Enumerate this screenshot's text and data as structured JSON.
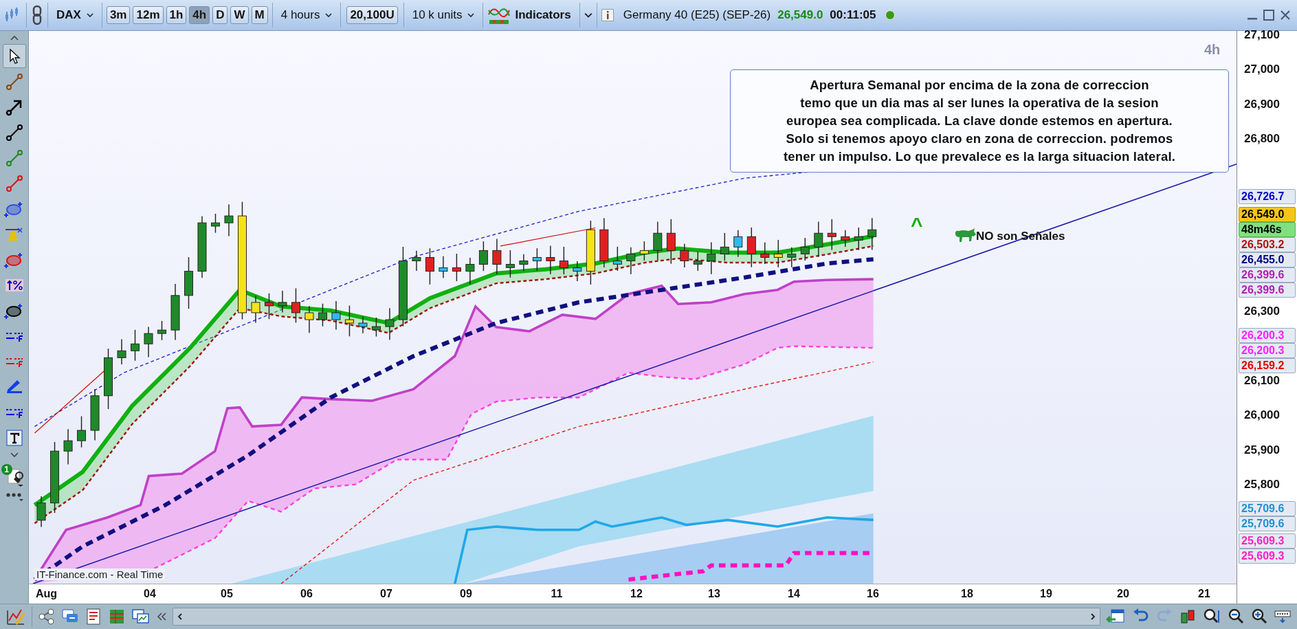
{
  "toolbar": {
    "symbol": "DAX",
    "timeframes": [
      {
        "label": "3m",
        "selected": false
      },
      {
        "label": "12m",
        "selected": false
      },
      {
        "label": "1h",
        "selected": false
      },
      {
        "label": "4h",
        "selected": true
      },
      {
        "label": "D",
        "selected": false
      },
      {
        "label": "W",
        "selected": false
      },
      {
        "label": "M",
        "selected": false
      }
    ],
    "period": "4 hours",
    "quantity_button": "20,100U",
    "units": "10 k units",
    "indicators": "Indicators",
    "instrument": "Germany 40 (E25) (SEP-26)",
    "price": "26,549.0",
    "countdown": "00:11:05",
    "connected": true
  },
  "drawing_tools": [
    {
      "kind": "pointer",
      "selected": true
    },
    {
      "kind": "segment",
      "selected": false
    },
    {
      "kind": "arrow",
      "selected": false
    },
    {
      "kind": "segment",
      "selected": false
    },
    {
      "kind": "segment",
      "selected": false
    },
    {
      "kind": "segment",
      "selected": false
    },
    {
      "kind": "ellipse",
      "selected": false
    },
    {
      "kind": "alert",
      "selected": false
    },
    {
      "kind": "ellipse",
      "selected": false
    },
    {
      "kind": "percent",
      "selected": false
    },
    {
      "kind": "ellipse",
      "selected": false
    },
    {
      "kind": "levels",
      "selected": false
    },
    {
      "kind": "levels",
      "selected": false
    },
    {
      "kind": "pencil",
      "selected": false
    },
    {
      "kind": "levels",
      "selected": false
    },
    {
      "kind": "text",
      "selected": false
    }
  ],
  "tools_badge": "1",
  "chart": {
    "timeframe_label": "4h",
    "note": [
      "Apertura Semanal por encima de la zona de correccion",
      "temo que un dia mas al ser lunes la operativa de la sesion",
      "europea sea complicada. La clave donde estemos en apertura.",
      "Solo si tenemos apoyo claro en zona de correccion. podremos",
      "tener un impulso. Lo que prevalece es la larga situacion lateral."
    ],
    "marker": "^",
    "signal_label": "NO son Señales",
    "source": "IT-Finance.com - Real Time",
    "price_ticks": [
      "27,100",
      "27,000",
      "26,900",
      "26,800",
      "26,300",
      "26,100",
      "26,000",
      "25,900",
      "25,800"
    ],
    "price_tags": [
      {
        "text": "26,726.7",
        "kind": "line",
        "color": "#0000c8"
      },
      {
        "text": "26,549.0",
        "kind": "last"
      },
      {
        "text": "48m46s",
        "kind": "timer"
      },
      {
        "text": "26,503.2",
        "kind": "line",
        "color": "#b01010"
      },
      {
        "text": "26,455.0",
        "kind": "line",
        "color": "#000080"
      },
      {
        "text": "26,399.6",
        "kind": "line",
        "color": "#b020b0"
      },
      {
        "text": "26,399.6",
        "kind": "line",
        "color": "#b020b0"
      },
      {
        "text": "26,200.3",
        "kind": "line",
        "color": "#ff20ff"
      },
      {
        "text": "26,200.3",
        "kind": "line",
        "color": "#ff20ff"
      },
      {
        "text": "26,159.2",
        "kind": "line",
        "color": "#e00000"
      },
      {
        "text": "25,709.6",
        "kind": "line",
        "color": "#2090d0"
      },
      {
        "text": "25,709.6",
        "kind": "line",
        "color": "#2090d0"
      },
      {
        "text": "25,609.3",
        "kind": "line",
        "color": "#ff20c0"
      },
      {
        "text": "25,609.3",
        "kind": "line",
        "color": "#ff20c0"
      }
    ],
    "date_labels": [
      "Aug",
      "04",
      "05",
      "06",
      "07",
      "09",
      "11",
      "12",
      "13",
      "14",
      "16",
      "18",
      "19",
      "20",
      "21"
    ]
  }
}
